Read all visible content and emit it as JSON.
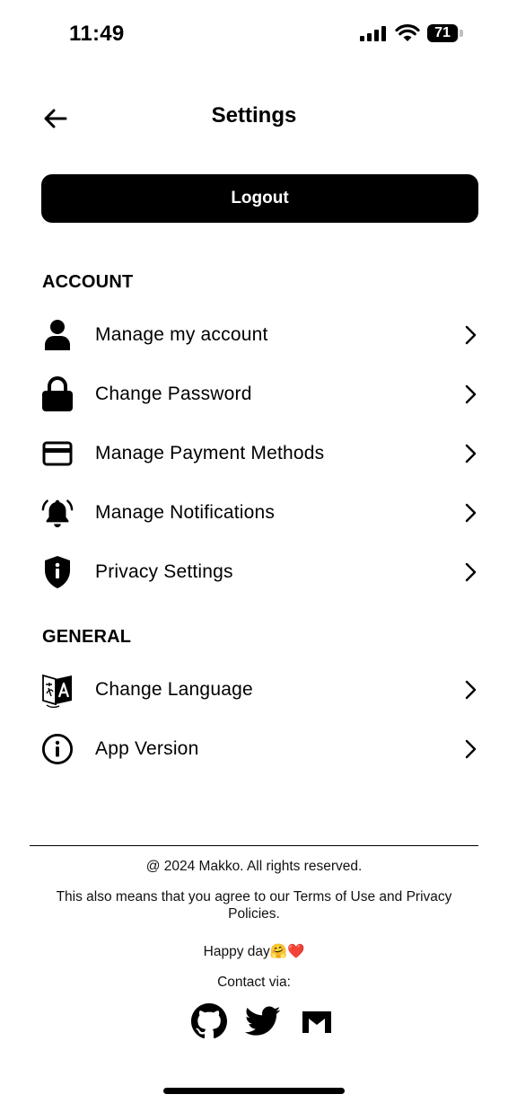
{
  "status_bar": {
    "time": "11:49",
    "battery": "71"
  },
  "header": {
    "title": "Settings",
    "back_icon": "arrow-left-icon"
  },
  "logout_label": "Logout",
  "sections": {
    "account": {
      "title": "ACCOUNT",
      "items": [
        {
          "label": "Manage my account",
          "icon": "user-icon"
        },
        {
          "label": "Change Password",
          "icon": "lock-icon"
        },
        {
          "label": "Manage Payment Methods",
          "icon": "credit-card-icon"
        },
        {
          "label": "Manage Notifications",
          "icon": "bell-ringing-icon"
        },
        {
          "label": "Privacy Settings",
          "icon": "shield-info-icon"
        }
      ]
    },
    "general": {
      "title": "GENERAL",
      "items": [
        {
          "label": "Change Language",
          "icon": "translate-icon"
        },
        {
          "label": "App Version",
          "icon": "info-circle-icon"
        }
      ]
    }
  },
  "footer": {
    "copyright": "@ 2024 Makko. All rights reserved.",
    "terms": "This also means that you agree to our Terms of Use and Privacy Policies.",
    "happy": "Happy day🤗❤️",
    "contact": "Contact via:",
    "socials": [
      "github-icon",
      "twitter-icon",
      "gmail-icon"
    ]
  }
}
